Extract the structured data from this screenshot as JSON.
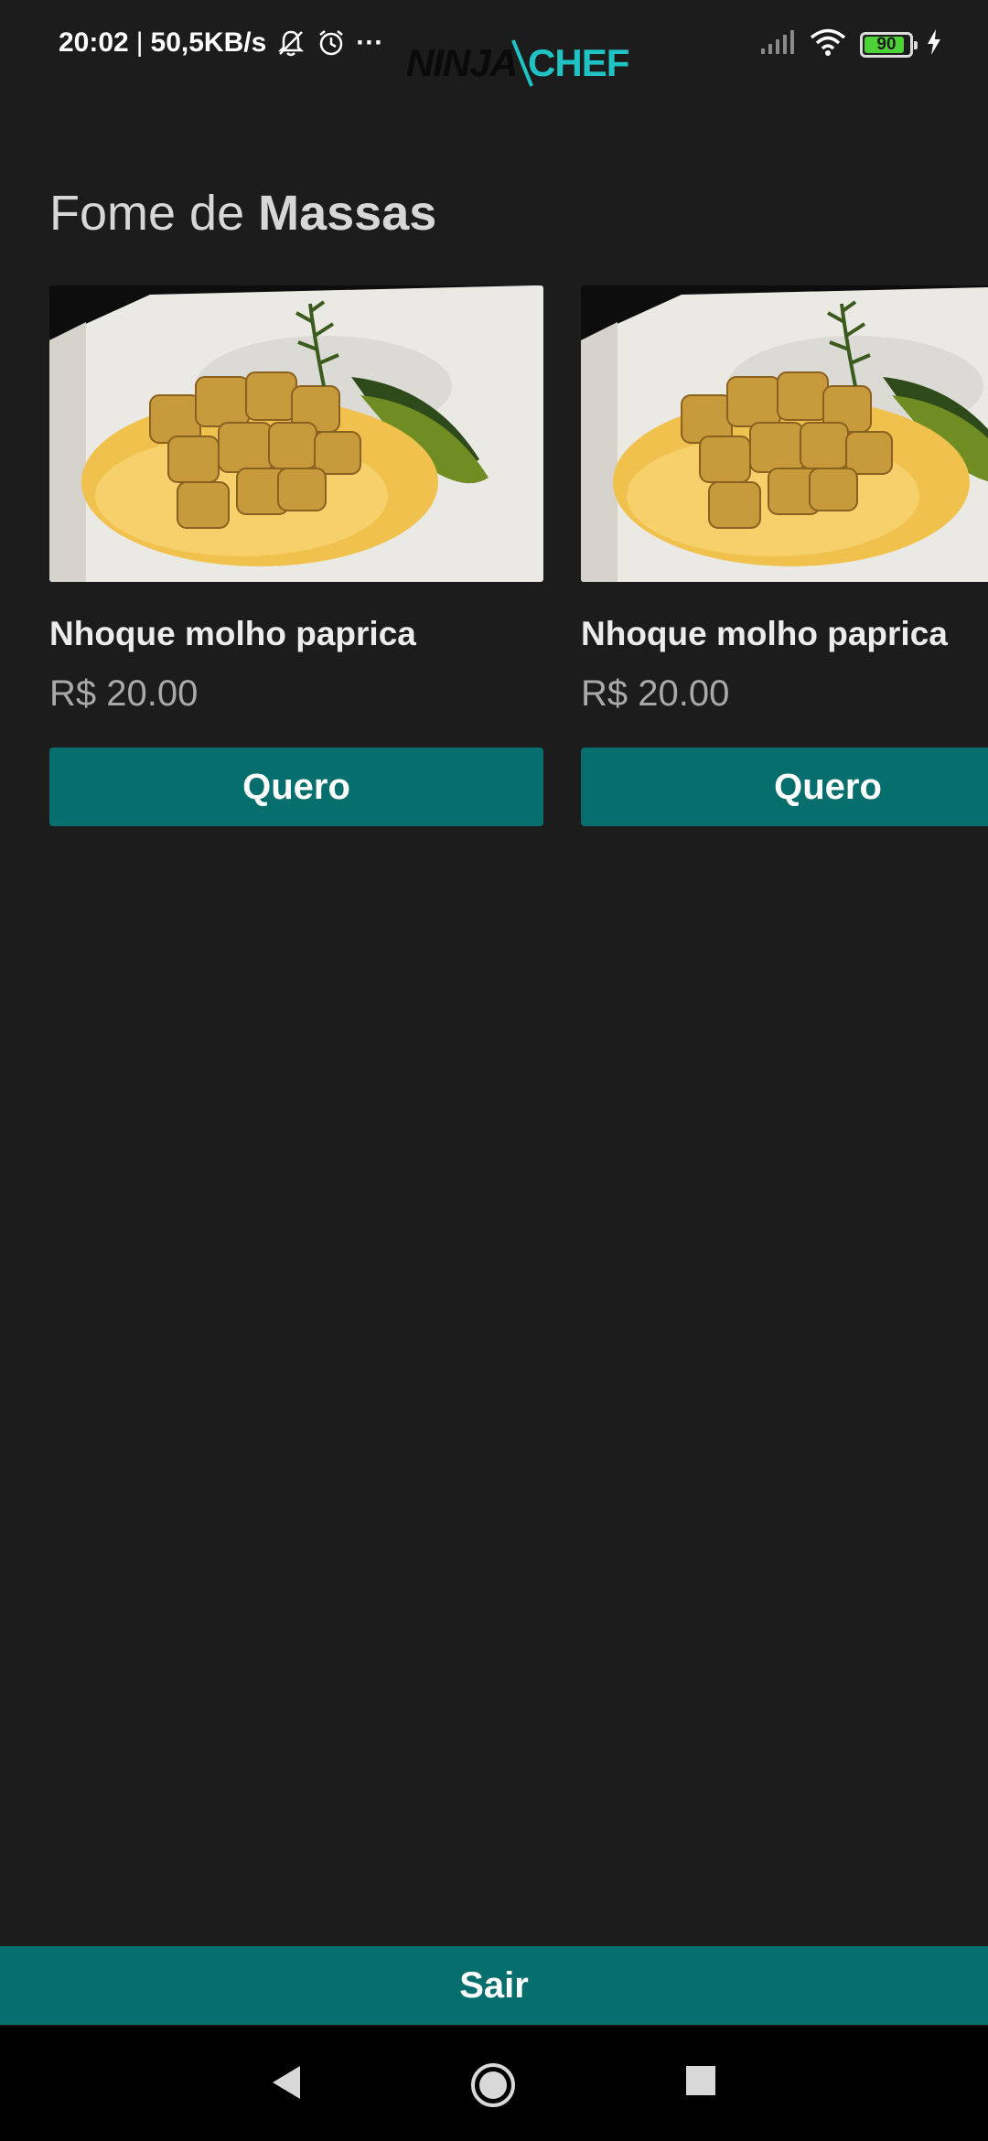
{
  "status_bar": {
    "time": "20:02",
    "separator": "|",
    "network_speed": "50,5KB/s",
    "more": "···",
    "battery_level": "90",
    "battery_fraction": 0.9,
    "icons": [
      "bell-off-icon",
      "alarm-icon",
      "signal-icon",
      "wifi-icon",
      "battery-icon",
      "charging-icon"
    ]
  },
  "logo": {
    "part1": "NINJA",
    "part2": "CHEF",
    "accent_color": "#1fc3c3"
  },
  "section": {
    "title_prefix": "Fome de",
    "title_bold": "Massas"
  },
  "products": [
    {
      "name": "Nhoque molho paprica",
      "price": "R$ 20.00",
      "button_label": "Quero"
    },
    {
      "name": "Nhoque molho paprica",
      "price": "R$ 20.00",
      "button_label": "Quero"
    }
  ],
  "footer": {
    "exit_label": "Sair"
  },
  "nav": {
    "icons": [
      "back-icon",
      "home-icon",
      "recents-icon"
    ]
  },
  "colors": {
    "background": "#1c1c1d",
    "primary": "#066e6c",
    "accent": "#1fc3c3",
    "price_text": "#a9a9a9"
  }
}
